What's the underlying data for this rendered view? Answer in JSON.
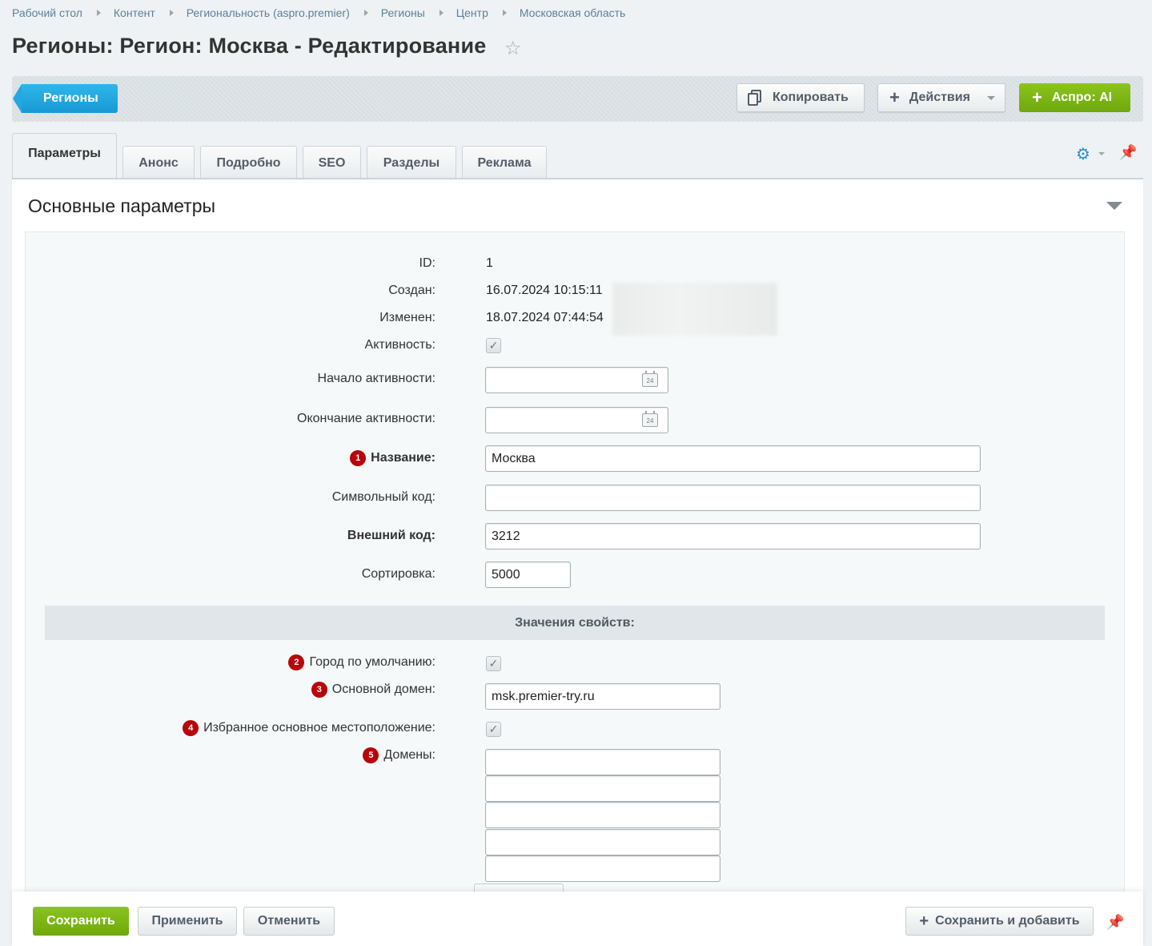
{
  "breadcrumb": [
    "Рабочий стол",
    "Контент",
    "Региональность (aspro.premier)",
    "Регионы",
    "Центр",
    "Московская область"
  ],
  "title": "Регионы: Регион: Москва - Редактирование",
  "toolbar": {
    "back_label": "Регионы",
    "copy_label": "Копировать",
    "actions_label": "Действия",
    "ai_label": "Аспро: AI"
  },
  "tabs": [
    "Параметры",
    "Анонс",
    "Подробно",
    "SEO",
    "Разделы",
    "Реклама"
  ],
  "section": {
    "title": "Основные параметры"
  },
  "fields": {
    "id_label": "ID:",
    "id_value": "1",
    "created_label": "Создан:",
    "created_value": "16.07.2024 10:15:11",
    "modified_label": "Изменен:",
    "modified_value": "18.07.2024 07:44:54",
    "active_label": "Активность:",
    "active_start_label": "Начало активности:",
    "active_end_label": "Окончание активности:",
    "name_label": "Название:",
    "name_value": "Москва",
    "code_label": "Символьный код:",
    "code_value": "",
    "xml_id_label": "Внешний код:",
    "xml_id_value": "3212",
    "sort_label": "Сортировка:",
    "sort_value": "5000",
    "calendar_day": "24"
  },
  "properties": {
    "header": "Значения свойств:",
    "default_city_label": "Город по умолчанию:",
    "main_domain_label": "Основной домен:",
    "main_domain_value": "msk.premier-try.ru",
    "favorite_location_label": "Избранное основное местоположение:",
    "domains_label": "Домены:",
    "domains": [
      "",
      "",
      "",
      "",
      ""
    ]
  },
  "badges": [
    "1",
    "2",
    "3",
    "4",
    "5"
  ],
  "footer": {
    "save_label": "Сохранить",
    "apply_label": "Применить",
    "cancel_label": "Отменить",
    "save_add_label": "Сохранить и добавить"
  },
  "colors": {
    "accent_blue": "#1899d4",
    "accent_green": "#7ab514",
    "badge_red": "#b8040a"
  }
}
